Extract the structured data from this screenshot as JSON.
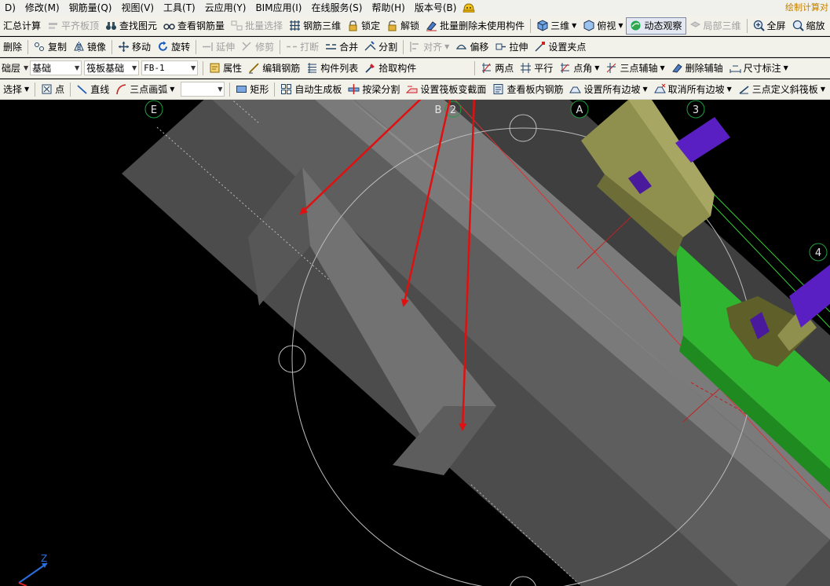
{
  "menu": {
    "items": [
      "D)",
      "修改(M)",
      "钢筋量(Q)",
      "视图(V)",
      "工具(T)",
      "云应用(Y)",
      "BIM应用(I)",
      "在线服务(S)",
      "帮助(H)",
      "版本号(B)"
    ],
    "right_note": "绘制计算对"
  },
  "toolbar1": {
    "summary_calc": "汇总计算",
    "level_top": "平齐板顶",
    "find_element": "查找图元",
    "view_rebar_qty": "查看钢筋量",
    "batch_select": "批量选择",
    "rebar_3d": "钢筋三维",
    "lock": "锁定",
    "unlock": "解锁",
    "batch_delete_unused": "批量删除未使用构件",
    "view_3d": "三维",
    "top_view": "俯视",
    "dynamic_observe": "动态观察",
    "local_3d": "局部三维",
    "fullscreen": "全屏",
    "zoom": "缩放"
  },
  "toolbar2": {
    "delete": "删除",
    "copy": "复制",
    "mirror": "镜像",
    "move": "移动",
    "rotate": "旋转",
    "extend": "延伸",
    "trim": "修剪",
    "break": "打断",
    "merge": "合并",
    "split": "分割",
    "align": "对齐",
    "offset": "偏移",
    "stretch": "拉伸",
    "set_grip": "设置夹点"
  },
  "toolbar3": {
    "layer_label": "础层",
    "floor_value": "基础",
    "type_value": "筏板基础",
    "component_value": "FB-1",
    "properties": "属性",
    "edit_rebar": "编辑钢筋",
    "component_list": "构件列表",
    "pick_component": "拾取构件",
    "two_points": "两点",
    "parallel": "平行",
    "point_angle": "点角",
    "three_point_axis": "三点辅轴",
    "delete_aux_axis": "删除辅轴",
    "dimension": "尺寸标注"
  },
  "toolbar4": {
    "select": "选择",
    "point": "点",
    "line": "直线",
    "three_point_arc": "三点画弧",
    "rect": "矩形",
    "auto_gen_slab": "自动生成板",
    "split_by_beam": "按梁分割",
    "set_raft_section_change": "设置筏板变截面",
    "view_slab_rebar": "查看板内钢筋",
    "set_all_edge_slopes": "设置所有边坡",
    "cancel_all_edge_slopes": "取消所有边坡",
    "three_point_slope_slab": "三点定义斜筏板"
  },
  "viewport": {
    "axis_labels": [
      "E",
      "B",
      "2",
      "A",
      "3",
      "4"
    ],
    "coord_label": "Z",
    "colors": {
      "background": "#000000",
      "slab_top": "#7a7a7a",
      "slab_side": "#4c4c4c",
      "beam_olive": "#8f8f4e",
      "beam_green": "#2fb52f",
      "purple": "#5a1fc2",
      "arrow_red": "#e01010"
    }
  }
}
